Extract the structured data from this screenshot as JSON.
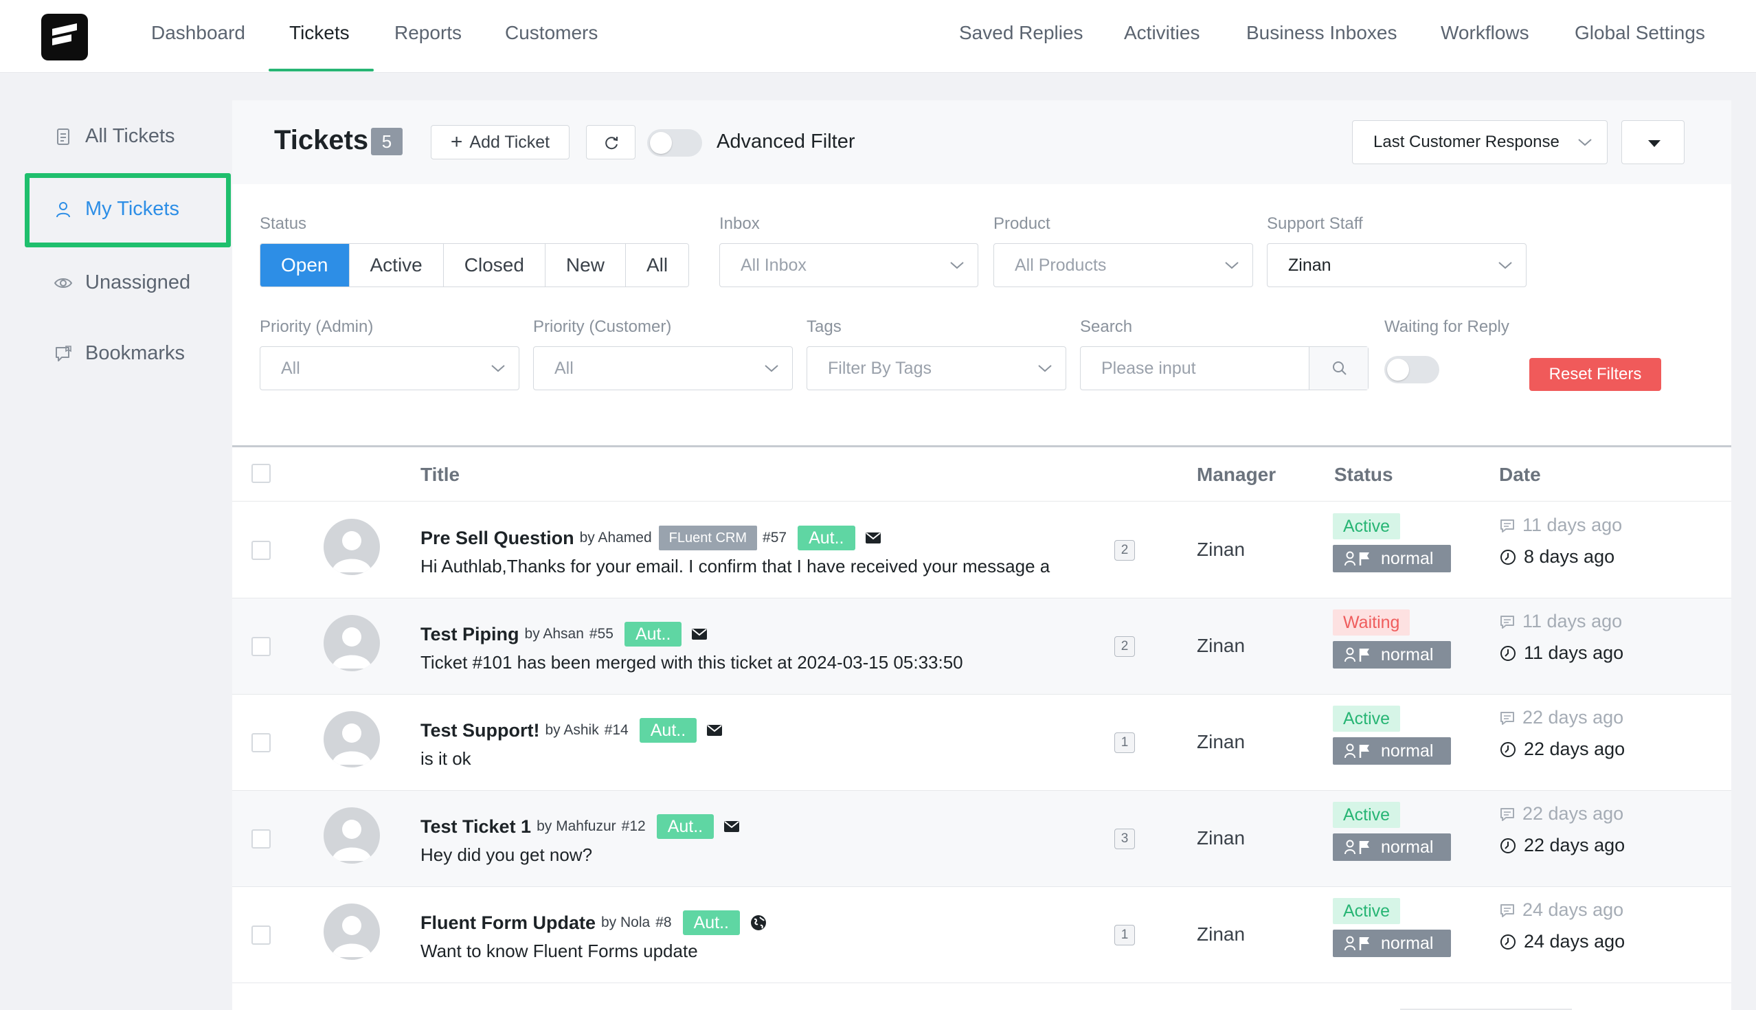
{
  "nav": {
    "left": [
      "Dashboard",
      "Tickets",
      "Reports",
      "Customers"
    ],
    "right": [
      "Saved Replies",
      "Activities",
      "Business Inboxes",
      "Workflows",
      "Global Settings"
    ],
    "active": "Tickets"
  },
  "sidebar": {
    "items": [
      {
        "label": "All Tickets",
        "icon": "document-icon"
      },
      {
        "label": "My Tickets",
        "icon": "user-icon"
      },
      {
        "label": "Unassigned",
        "icon": "eye-icon"
      },
      {
        "label": "Bookmarks",
        "icon": "bookmark-icon"
      }
    ],
    "active": "My Tickets"
  },
  "header": {
    "title": "Tickets",
    "count": "5",
    "add_label": "Add Ticket",
    "advanced_filter_label": "Advanced Filter",
    "sort_value": "Last Customer Response",
    "advanced_filter_on": false
  },
  "filters": {
    "status_label": "Status",
    "status_options": [
      "Open",
      "Active",
      "Closed",
      "New",
      "All"
    ],
    "status_selected": "Open",
    "inbox_label": "Inbox",
    "inbox_placeholder": "All Inbox",
    "product_label": "Product",
    "product_placeholder": "All Products",
    "staff_label": "Support Staff",
    "staff_value": "Zinan",
    "priority_admin_label": "Priority (Admin)",
    "priority_admin_value": "All",
    "priority_customer_label": "Priority (Customer)",
    "priority_customer_value": "All",
    "tags_label": "Tags",
    "tags_placeholder": "Filter By Tags",
    "search_label": "Search",
    "search_placeholder": "Please input",
    "waiting_label": "Waiting for Reply",
    "waiting_on": false,
    "reset_label": "Reset Filters"
  },
  "table": {
    "columns": {
      "title": "Title",
      "manager": "Manager",
      "status": "Status",
      "date": "Date"
    },
    "rows": [
      {
        "title": "Pre Sell Question",
        "by": "by Ahamed",
        "crm": "FLuent CRM",
        "num": "#57",
        "aut": "Aut..",
        "channel": "mail-icon",
        "preview": "Hi Authlab,Thanks for your email. I confirm that I have received your message a",
        "count": "2",
        "manager": "Zinan",
        "status": "Active",
        "priority": "normal",
        "date1": "11 days ago",
        "date2": "8 days ago"
      },
      {
        "title": "Test Piping",
        "by": "by Ahsan",
        "num": "#55",
        "aut": "Aut..",
        "channel": "mail-icon",
        "preview": "Ticket #101 has been merged with this ticket at 2024-03-15 05:33:50",
        "count": "2",
        "manager": "Zinan",
        "status": "Waiting",
        "priority": "normal",
        "date1": "11 days ago",
        "date2": "11 days ago"
      },
      {
        "title": "Test Support!",
        "by": "by Ashik",
        "num": "#14",
        "aut": "Aut..",
        "channel": "mail-icon",
        "preview": "is it ok",
        "count": "1",
        "manager": "Zinan",
        "status": "Active",
        "priority": "normal",
        "date1": "22 days ago",
        "date2": "22 days ago"
      },
      {
        "title": "Test Ticket 1",
        "by": "by Mahfuzur",
        "num": "#12",
        "aut": "Aut..",
        "channel": "mail-icon",
        "preview": "Hey did you get now?",
        "count": "3",
        "manager": "Zinan",
        "status": "Active",
        "priority": "normal",
        "date1": "22 days ago",
        "date2": "22 days ago"
      },
      {
        "title": "Fluent Form Update",
        "by": "by Nola",
        "num": "#8",
        "aut": "Aut..",
        "channel": "globe-icon",
        "preview": "Want to know Fluent Forms update",
        "count": "1",
        "manager": "Zinan",
        "status": "Active",
        "priority": "normal",
        "date1": "24 days ago",
        "date2": "24 days ago"
      }
    ]
  },
  "colors": {
    "accent": "#2d8ee6",
    "active_green": "#27b574",
    "waiting_red": "#ef5d5d",
    "reset": "#f05a5a",
    "highlight_box": "#1fbf6d"
  }
}
